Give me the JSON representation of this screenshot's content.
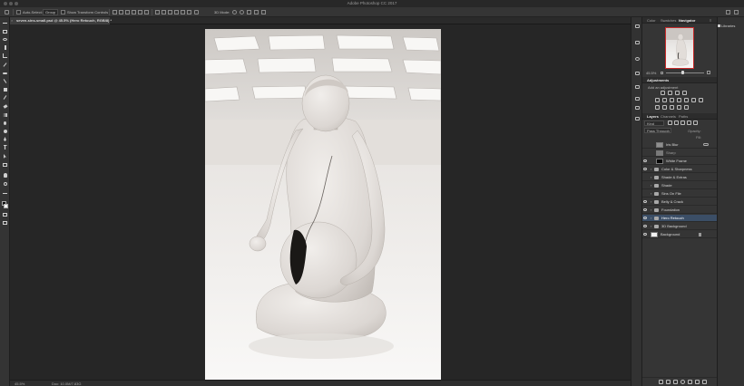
{
  "app": {
    "title": "Adobe Photoshop CC 2017"
  },
  "options": {
    "auto_select_label": "Auto-Select:",
    "auto_select_value": "Group",
    "transform_label": "Show Transform Controls",
    "mode_label": "3D Mode:"
  },
  "document": {
    "tab_title": "seven-sins-small.psd @ 45.5% (Hero Retouch, RGB/8) *",
    "close_glyph": "×"
  },
  "status": {
    "zoom": "45.5%",
    "doc_info": "Doc: 10.0M/7.83G"
  },
  "panels": {
    "top_tabs": [
      {
        "label": "Color",
        "active": false
      },
      {
        "label": "Swatches",
        "active": false
      },
      {
        "label": "Navigator",
        "active": true
      }
    ],
    "navigator_zoom": "45.5%",
    "adjustments": {
      "title": "Adjustments",
      "subtitle": "Add an adjustment"
    },
    "layer_tabs": [
      {
        "label": "Layers",
        "active": true
      },
      {
        "label": "Channels",
        "active": false
      },
      {
        "label": "Paths",
        "active": false
      }
    ],
    "kind_label": "Kind",
    "blend_mode": "Pass Through",
    "opacity_label": "Opacity:",
    "fill_label": "Fill:",
    "libraries_label": "Libraries"
  },
  "layers": [
    {
      "name": "Iris Blur",
      "visible": false,
      "type": "smart",
      "selected": false
    },
    {
      "name": "Sharp",
      "visible": false,
      "type": "pixel",
      "selected": false
    },
    {
      "name": "White Frame",
      "visible": true,
      "type": "fill",
      "selected": false
    },
    {
      "name": "Color & Sharpness",
      "visible": true,
      "type": "group",
      "selected": false
    },
    {
      "name": "Shade & Extras",
      "visible": false,
      "type": "group",
      "selected": false
    },
    {
      "name": "Shade",
      "visible": false,
      "type": "group",
      "selected": false
    },
    {
      "name": "Sins On File",
      "visible": false,
      "type": "group",
      "selected": false
    },
    {
      "name": "Belly & Crack",
      "visible": true,
      "type": "group",
      "selected": false
    },
    {
      "name": "Foundation",
      "visible": true,
      "type": "group",
      "selected": false
    },
    {
      "name": "Hero Retouch",
      "visible": true,
      "type": "group",
      "selected": true
    },
    {
      "name": "3D Background",
      "visible": true,
      "type": "group",
      "selected": false
    },
    {
      "name": "Background",
      "visible": true,
      "type": "pixel",
      "selected": false
    }
  ],
  "colors": {
    "selection": "#3b4e66",
    "navigator_frame": "#c72a2a",
    "ui_dark": "#353535"
  }
}
